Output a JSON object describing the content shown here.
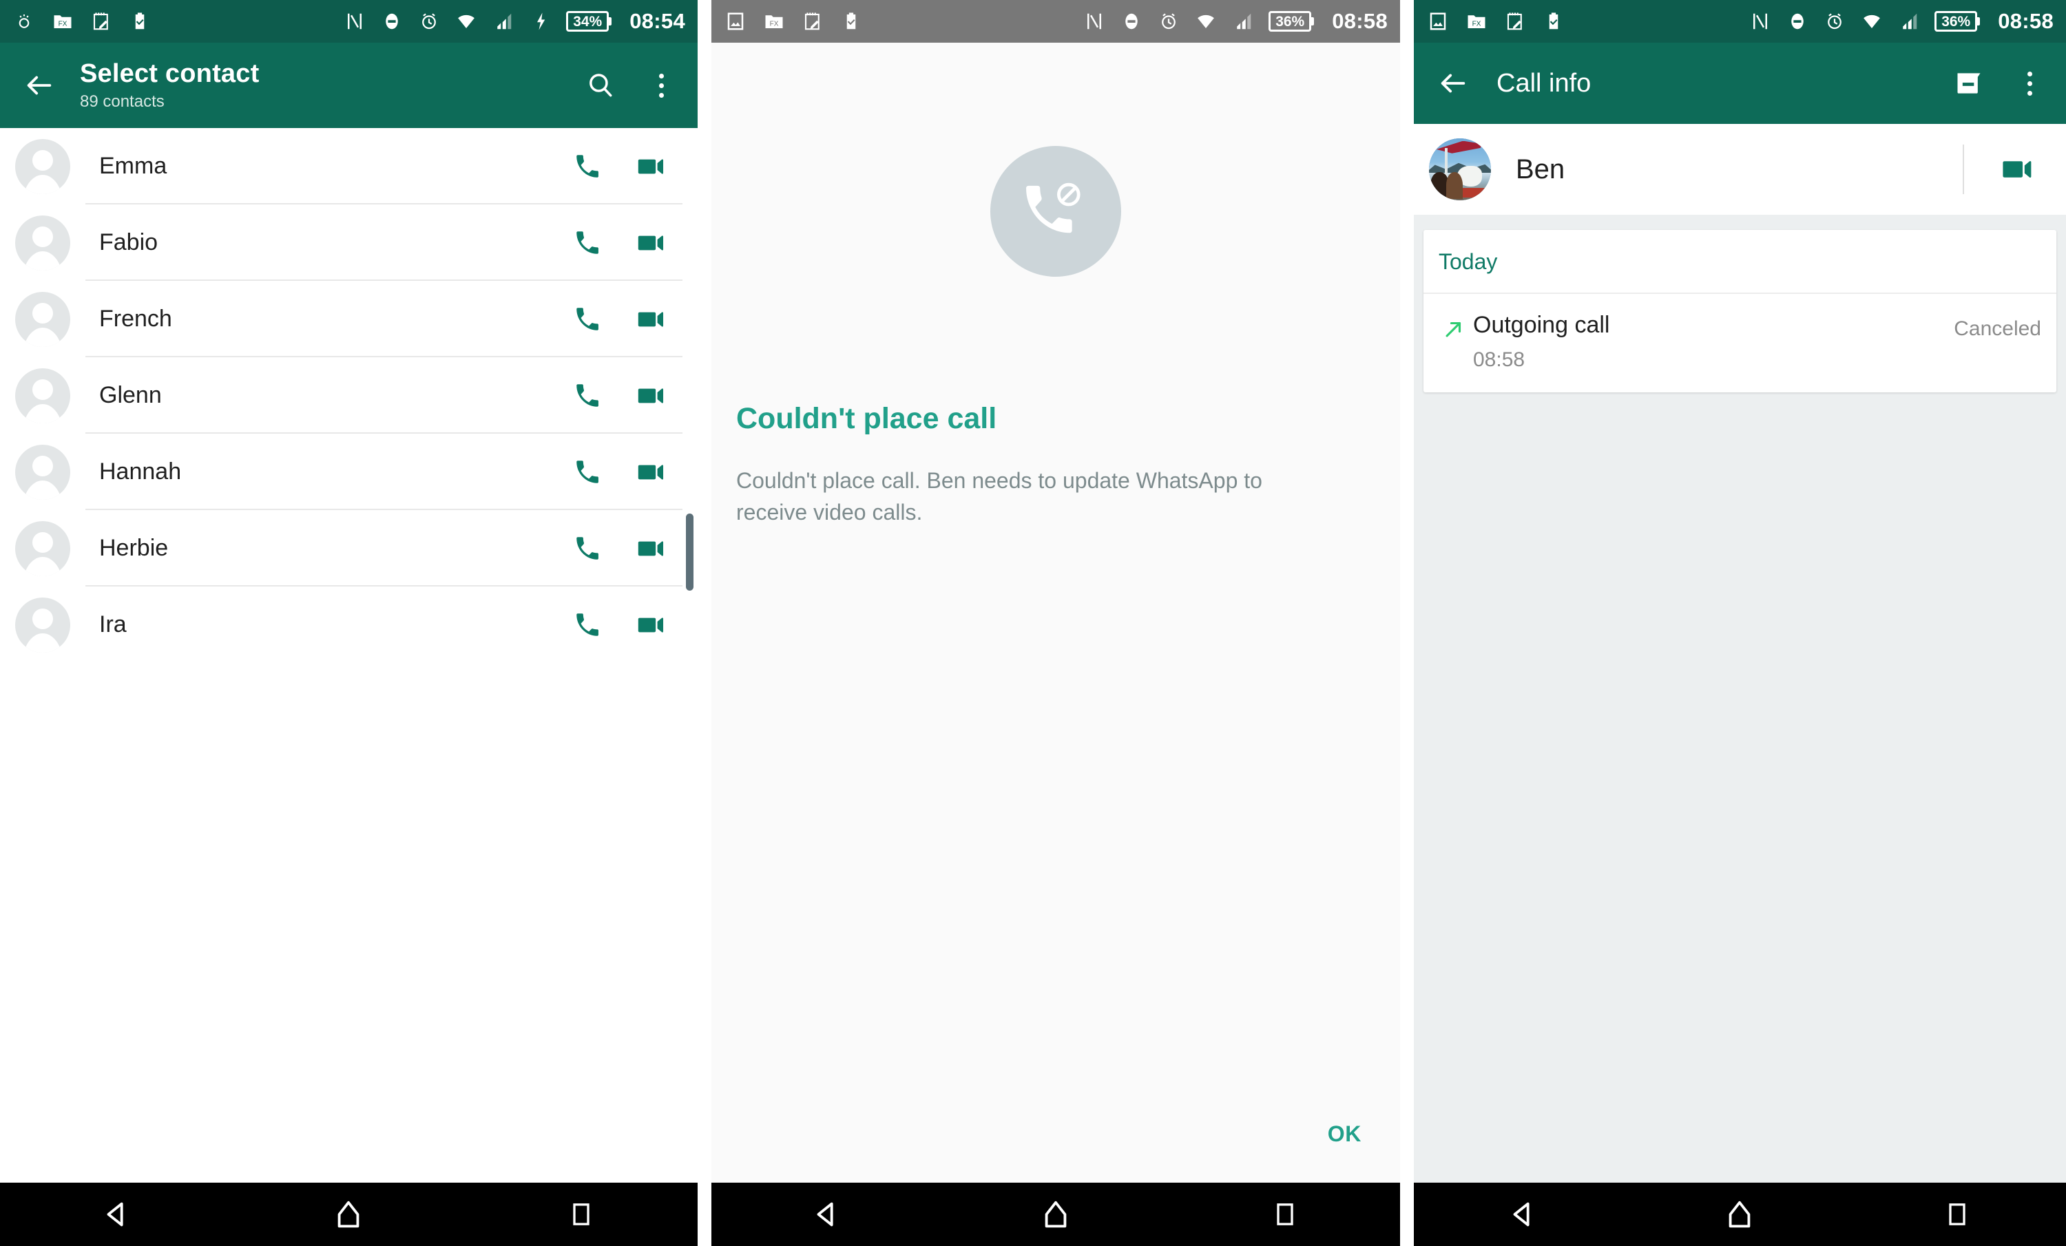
{
  "panel1": {
    "statusbar": {
      "left_icons": [
        "lightbulb-icon",
        "file-manager-icon",
        "notes-icon",
        "clipboard-check-icon"
      ],
      "right_icons": [
        "nfc-icon",
        "do-not-disturb-icon",
        "alarm-icon",
        "wifi-icon",
        "cellular-signal-icon",
        "charging-bolt-icon"
      ],
      "battery": "34%",
      "time": "08:54"
    },
    "appbar": {
      "back": "back-arrow-icon",
      "title": "Select contact",
      "subtitle": "89 contacts",
      "search": "search-icon",
      "overflow": "overflow-menu-icon"
    },
    "contacts": [
      {
        "name": "Emma",
        "call": "phone-icon",
        "video": "video-icon"
      },
      {
        "name": "Fabio",
        "call": "phone-icon",
        "video": "video-icon"
      },
      {
        "name": "French",
        "call": "phone-icon",
        "video": "video-icon"
      },
      {
        "name": "Glenn",
        "call": "phone-icon",
        "video": "video-icon"
      },
      {
        "name": "Hannah",
        "call": "phone-icon",
        "video": "video-icon"
      },
      {
        "name": "Herbie",
        "call": "phone-icon",
        "video": "video-icon"
      },
      {
        "name": "Ira",
        "call": "phone-icon",
        "video": "video-icon"
      }
    ]
  },
  "panel2": {
    "statusbar": {
      "left_icons": [
        "image-icon",
        "file-manager-icon",
        "notes-icon",
        "clipboard-check-icon"
      ],
      "right_icons": [
        "nfc-icon",
        "do-not-disturb-icon",
        "alarm-icon",
        "wifi-icon",
        "cellular-signal-icon"
      ],
      "battery": "36%",
      "time": "08:58"
    },
    "dialog": {
      "icon": "call-blocked-icon",
      "title": "Couldn't place call",
      "body": "Couldn't place call. Ben needs to update WhatsApp to receive video calls.",
      "ok_label": "OK"
    }
  },
  "panel3": {
    "statusbar": {
      "left_icons": [
        "image-icon",
        "file-manager-icon",
        "notes-icon",
        "clipboard-check-icon"
      ],
      "right_icons": [
        "nfc-icon",
        "do-not-disturb-icon",
        "alarm-icon",
        "wifi-icon",
        "cellular-signal-icon"
      ],
      "battery": "36%",
      "time": "08:58"
    },
    "appbar": {
      "back": "back-arrow-icon",
      "title": "Call info",
      "message_action": "message-icon",
      "overflow": "overflow-menu-icon"
    },
    "contact": {
      "avatar": "contact-photo-avatar",
      "name": "Ben",
      "video_action": "video-icon"
    },
    "card": {
      "section_label": "Today",
      "entry": {
        "direction_icon": "outgoing-call-arrow-icon",
        "title": "Outgoing call",
        "time": "08:58",
        "status": "Canceled"
      }
    }
  },
  "navbar": {
    "back": "nav-back-icon",
    "home": "nav-home-icon",
    "recents": "nav-recents-icon"
  },
  "colors": {
    "appbar_green": "#0d6b58",
    "statusbar_green": "#0d5c4d",
    "statusbar_gray": "#787878",
    "accent_teal": "#21a08a",
    "icon_teal": "#0d7a66",
    "today_green": "#0f7a66",
    "arrow_green": "#2ecc71"
  }
}
